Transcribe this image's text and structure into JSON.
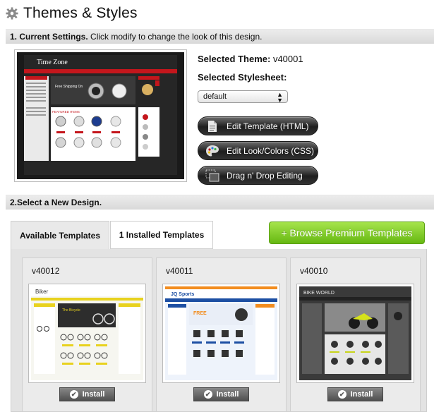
{
  "page": {
    "title": "Themes & Styles"
  },
  "current_settings": {
    "bar_label_bold": "1. Current Settings.",
    "bar_label_rest": " Click modify to change the look of this design.",
    "selected_theme_label": "Selected Theme:",
    "selected_theme_value": "v40001",
    "selected_stylesheet_label": "Selected Stylesheet:",
    "stylesheet_value": "default",
    "preview_store_name": "Time Zone",
    "buttons": {
      "edit_html": "Edit Template (HTML)",
      "edit_css": "Edit Look/Colors (CSS)",
      "drag_drop": "Drag n' Drop Editing"
    }
  },
  "new_design": {
    "bar_label": "2.Select a New Design.",
    "tabs": {
      "available": "Available Templates",
      "installed": "1 Installed Templates"
    },
    "premium_button": "+ Browse Premium Templates",
    "install_label": "Install",
    "templates": [
      {
        "name": "v40012",
        "logo": "Biker"
      },
      {
        "name": "v40011",
        "logo": "JQ Sports"
      },
      {
        "name": "v40010",
        "logo": "BIKE WORLD"
      }
    ]
  },
  "colors": {
    "premium_green": "#7bc626",
    "dark_button": "#2a2a2a",
    "preview_red": "#c4161c",
    "sports_blue": "#1d4fa3",
    "sports_orange": "#f28c1e"
  }
}
